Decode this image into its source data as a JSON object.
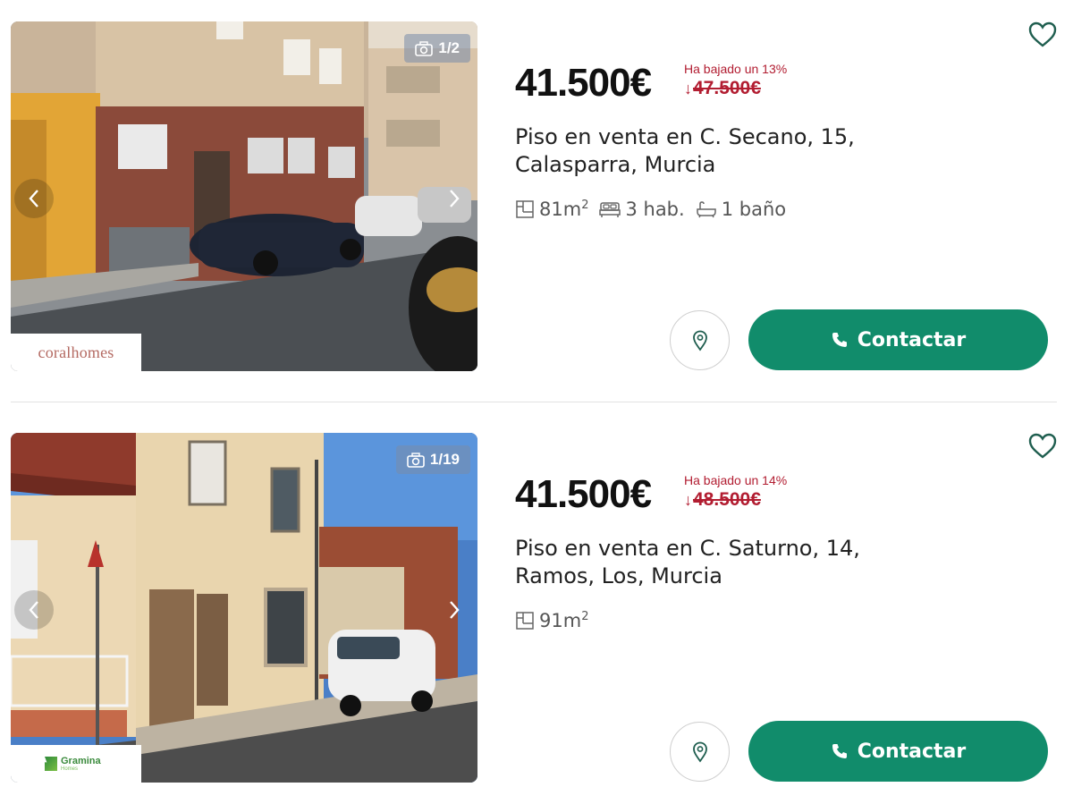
{
  "listings": [
    {
      "photo_counter": "1/2",
      "agency": "coralhomes",
      "price": "41.500€",
      "price_drop_note": "Ha bajado un 13%",
      "old_price": "47.500€",
      "title_line1": "Piso en venta en C. Secano, 15,",
      "title_line2": "Calasparra, Murcia",
      "features": {
        "area": "81m",
        "area_unit": "2",
        "rooms": "3 hab.",
        "baths": "1 baño"
      },
      "contact_label": "Contactar"
    },
    {
      "photo_counter": "1/19",
      "agency_name": "Gramina",
      "agency_sub": "Homes",
      "price": "41.500€",
      "price_drop_note": "Ha bajado un 14%",
      "old_price": "48.500€",
      "title_line1": "Piso en venta en C. Saturno, 14,",
      "title_line2": "Ramos, Los, Murcia",
      "features": {
        "area": "91m",
        "area_unit": "2"
      },
      "contact_label": "Contactar"
    }
  ],
  "icons": {
    "favorite": "heart-icon",
    "camera": "camera-icon",
    "map": "map-pin-icon",
    "phone": "phone-icon",
    "area": "floorplan-icon",
    "rooms": "bed-icon",
    "baths": "bathtub-icon"
  },
  "colors": {
    "accent": "#118c6b",
    "price_drop": "#b21d31",
    "agency_coral": "#b46a62"
  }
}
